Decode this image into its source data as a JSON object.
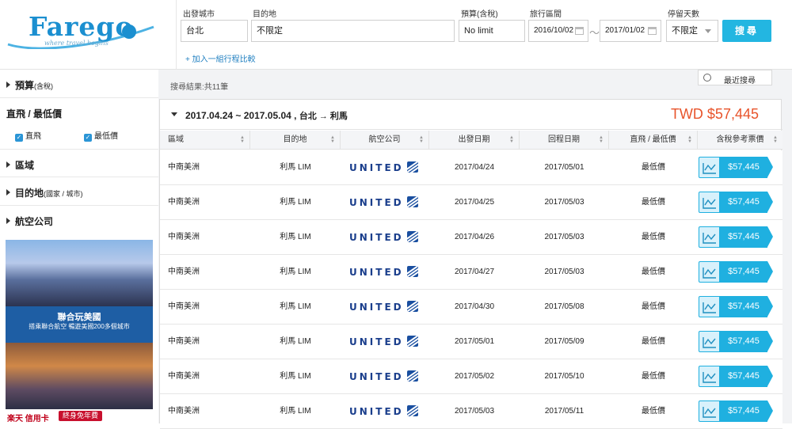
{
  "header": {
    "logo_text": "Farego",
    "logo_tagline": "where travel begins",
    "labels": {
      "origin": "出發城市",
      "destination": "目的地",
      "budget": "預算(含稅)",
      "period": "旅行區間",
      "stay": "停留天數"
    },
    "values": {
      "origin": "台北",
      "destination": "不限定",
      "budget": "No limit",
      "date_from": "2016/10/02",
      "date_sep": "～",
      "date_to": "2017/01/02",
      "stay": "不限定"
    },
    "search_button": "搜尋",
    "add_trip": "+ 加入一組行程比較"
  },
  "sidebar": {
    "budget": {
      "title": "預算",
      "note": "(含稅)"
    },
    "flight_type": {
      "title": "直飛 / 最低價",
      "options": [
        "直飛",
        "最低價"
      ]
    },
    "region": {
      "title": "區域"
    },
    "destination": {
      "title": "目的地",
      "note": "(國家 / 城市)"
    },
    "airline": {
      "title": "航空公司"
    },
    "ad": {
      "title": "聯合玩美國",
      "subtitle": "搭乘聯合航空 暢遊美國200多個城市",
      "brand": "楽",
      "brand_suffix": "天 信用卡",
      "badge": "終身免年費"
    }
  },
  "results": {
    "count_text": "搜尋結果:共11筆",
    "recent_text": "最近搜尋",
    "group": {
      "route_dates": "2017.04.24 ~ 2017.05.04 ,",
      "route_cities": "台北 → 利馬",
      "price": "TWD $57,445"
    },
    "columns": [
      "區域",
      "目的地",
      "航空公司",
      "出發日期",
      "回程日期",
      "直飛 / 最低價",
      "含稅參考票價"
    ],
    "rows": [
      {
        "region": "中南美洲",
        "dest": "利馬 LIM",
        "airline": "UNITED",
        "depart": "2017/04/24",
        "return": "2017/05/01",
        "type": "最低價",
        "price": "$57,445"
      },
      {
        "region": "中南美洲",
        "dest": "利馬 LIM",
        "airline": "UNITED",
        "depart": "2017/04/25",
        "return": "2017/05/03",
        "type": "最低價",
        "price": "$57,445"
      },
      {
        "region": "中南美洲",
        "dest": "利馬 LIM",
        "airline": "UNITED",
        "depart": "2017/04/26",
        "return": "2017/05/03",
        "type": "最低價",
        "price": "$57,445"
      },
      {
        "region": "中南美洲",
        "dest": "利馬 LIM",
        "airline": "UNITED",
        "depart": "2017/04/27",
        "return": "2017/05/03",
        "type": "最低價",
        "price": "$57,445"
      },
      {
        "region": "中南美洲",
        "dest": "利馬 LIM",
        "airline": "UNITED",
        "depart": "2017/04/30",
        "return": "2017/05/08",
        "type": "最低價",
        "price": "$57,445"
      },
      {
        "region": "中南美洲",
        "dest": "利馬 LIM",
        "airline": "UNITED",
        "depart": "2017/05/01",
        "return": "2017/05/09",
        "type": "最低價",
        "price": "$57,445"
      },
      {
        "region": "中南美洲",
        "dest": "利馬 LIM",
        "airline": "UNITED",
        "depart": "2017/05/02",
        "return": "2017/05/10",
        "type": "最低價",
        "price": "$57,445"
      },
      {
        "region": "中南美洲",
        "dest": "利馬 LIM",
        "airline": "UNITED",
        "depart": "2017/05/03",
        "return": "2017/05/11",
        "type": "最低價",
        "price": "$57,445"
      }
    ]
  },
  "colors": {
    "accent": "#1fb0e0",
    "price": "#e8542b",
    "brand": "#1b8fd0",
    "airline": "#1a3e8c"
  }
}
